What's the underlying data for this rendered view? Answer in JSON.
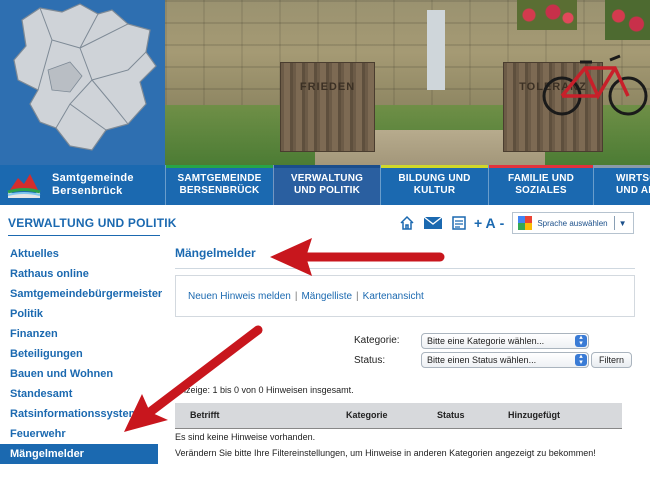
{
  "header": {
    "brand_line1": "Samtgemeinde",
    "brand_line2": "Bersenbrück",
    "photo_crate_left": "FRIEDEN",
    "photo_crate_right": "TOLERANZ"
  },
  "nav": {
    "tabs": [
      {
        "line1": "SAMTGEMEINDE",
        "line2": "BERSENBRÜCK"
      },
      {
        "line1": "VERWALTUNG",
        "line2": "UND POLITIK"
      },
      {
        "line1": "BILDUNG UND",
        "line2": "KULTUR"
      },
      {
        "line1": "FAMILIE UND",
        "line2": "SOZIALES"
      },
      {
        "line1": "WIRTSC",
        "line2": "UND AI"
      }
    ],
    "stripe_colors": [
      "#27a448",
      "#1a4d8b",
      "#cfd82a",
      "#e2313d",
      "#8b9aa8"
    ]
  },
  "section": {
    "title": "VERWALTUNG UND POLITIK"
  },
  "toolbar": {
    "font_plus": "+ A",
    "font_minus": "-",
    "language_label": "Sprache auswählen"
  },
  "sidebar": {
    "items": [
      "Aktuelles",
      "Rathaus online",
      "Samtgemeindebürgermeister",
      "Politik",
      "Finanzen",
      "Beteiligungen",
      "Bauen und Wohnen",
      "Standesamt",
      "Ratsinformationssystem",
      "Feuerwehr",
      "Mängelmelder"
    ],
    "active_index": 10
  },
  "main": {
    "title": "Mängelmelder",
    "links": [
      "Neuen Hinweis melden",
      "Mängelliste",
      "Kartenansicht"
    ],
    "filters": {
      "category_label": "Kategorie:",
      "category_value": "Bitte eine Kategorie wählen...",
      "status_label": "Status:",
      "status_value": "Bitte einen Status wählen...",
      "filter_button": "Filtern"
    },
    "count_text": "Anzeige: 1 bis 0 von 0 Hinweisen insgesamt.",
    "table": {
      "headers": [
        "Betrifft",
        "Kategorie",
        "Status",
        "Hinzugefügt"
      ]
    },
    "empty_line1": "Es sind keine Hinweise vorhanden.",
    "empty_line2": "Verändern Sie bitte Ihre Filtereinstellungen, um Hinweise in anderen Kategorien angezeigt zu bekommen!"
  },
  "colors": {
    "brand_blue": "#1b69b0",
    "arrow_red": "#c8161d"
  }
}
